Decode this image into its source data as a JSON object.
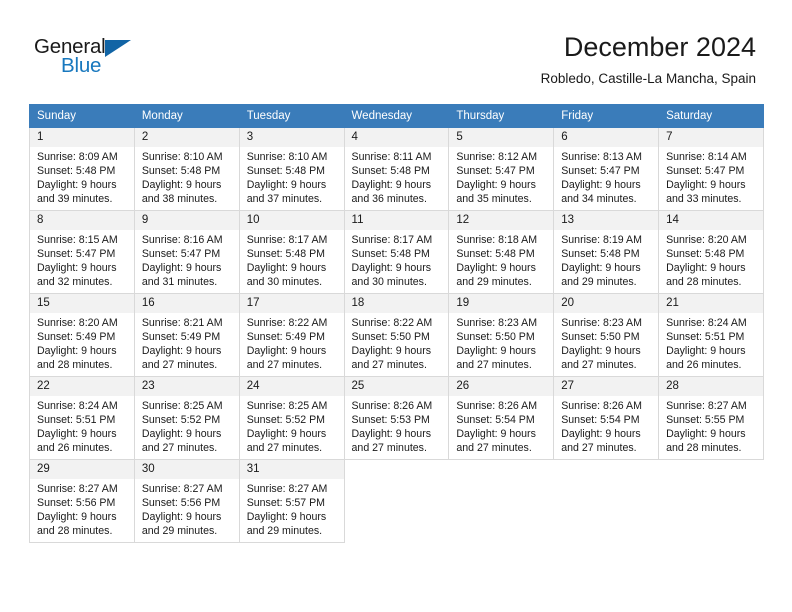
{
  "brand": {
    "name_part1": "General",
    "name_part2": "Blue",
    "triangle_color": "#1164a5",
    "blue_color": "#1878be"
  },
  "header": {
    "title": "December 2024",
    "subtitle": "Robledo, Castille-La Mancha, Spain"
  },
  "theme": {
    "header_bg": "#3a7cba",
    "daynum_bg": "#f2f2f2",
    "grid_border": "#d9d9d9"
  },
  "weekday_headers": [
    "Sunday",
    "Monday",
    "Tuesday",
    "Wednesday",
    "Thursday",
    "Friday",
    "Saturday"
  ],
  "weeks": [
    [
      {
        "day": "1",
        "sunrise": "Sunrise: 8:09 AM",
        "sunset": "Sunset: 5:48 PM",
        "daylight1": "Daylight: 9 hours",
        "daylight2": "and 39 minutes."
      },
      {
        "day": "2",
        "sunrise": "Sunrise: 8:10 AM",
        "sunset": "Sunset: 5:48 PM",
        "daylight1": "Daylight: 9 hours",
        "daylight2": "and 38 minutes."
      },
      {
        "day": "3",
        "sunrise": "Sunrise: 8:10 AM",
        "sunset": "Sunset: 5:48 PM",
        "daylight1": "Daylight: 9 hours",
        "daylight2": "and 37 minutes."
      },
      {
        "day": "4",
        "sunrise": "Sunrise: 8:11 AM",
        "sunset": "Sunset: 5:48 PM",
        "daylight1": "Daylight: 9 hours",
        "daylight2": "and 36 minutes."
      },
      {
        "day": "5",
        "sunrise": "Sunrise: 8:12 AM",
        "sunset": "Sunset: 5:47 PM",
        "daylight1": "Daylight: 9 hours",
        "daylight2": "and 35 minutes."
      },
      {
        "day": "6",
        "sunrise": "Sunrise: 8:13 AM",
        "sunset": "Sunset: 5:47 PM",
        "daylight1": "Daylight: 9 hours",
        "daylight2": "and 34 minutes."
      },
      {
        "day": "7",
        "sunrise": "Sunrise: 8:14 AM",
        "sunset": "Sunset: 5:47 PM",
        "daylight1": "Daylight: 9 hours",
        "daylight2": "and 33 minutes."
      }
    ],
    [
      {
        "day": "8",
        "sunrise": "Sunrise: 8:15 AM",
        "sunset": "Sunset: 5:47 PM",
        "daylight1": "Daylight: 9 hours",
        "daylight2": "and 32 minutes."
      },
      {
        "day": "9",
        "sunrise": "Sunrise: 8:16 AM",
        "sunset": "Sunset: 5:47 PM",
        "daylight1": "Daylight: 9 hours",
        "daylight2": "and 31 minutes."
      },
      {
        "day": "10",
        "sunrise": "Sunrise: 8:17 AM",
        "sunset": "Sunset: 5:48 PM",
        "daylight1": "Daylight: 9 hours",
        "daylight2": "and 30 minutes."
      },
      {
        "day": "11",
        "sunrise": "Sunrise: 8:17 AM",
        "sunset": "Sunset: 5:48 PM",
        "daylight1": "Daylight: 9 hours",
        "daylight2": "and 30 minutes."
      },
      {
        "day": "12",
        "sunrise": "Sunrise: 8:18 AM",
        "sunset": "Sunset: 5:48 PM",
        "daylight1": "Daylight: 9 hours",
        "daylight2": "and 29 minutes."
      },
      {
        "day": "13",
        "sunrise": "Sunrise: 8:19 AM",
        "sunset": "Sunset: 5:48 PM",
        "daylight1": "Daylight: 9 hours",
        "daylight2": "and 29 minutes."
      },
      {
        "day": "14",
        "sunrise": "Sunrise: 8:20 AM",
        "sunset": "Sunset: 5:48 PM",
        "daylight1": "Daylight: 9 hours",
        "daylight2": "and 28 minutes."
      }
    ],
    [
      {
        "day": "15",
        "sunrise": "Sunrise: 8:20 AM",
        "sunset": "Sunset: 5:49 PM",
        "daylight1": "Daylight: 9 hours",
        "daylight2": "and 28 minutes."
      },
      {
        "day": "16",
        "sunrise": "Sunrise: 8:21 AM",
        "sunset": "Sunset: 5:49 PM",
        "daylight1": "Daylight: 9 hours",
        "daylight2": "and 27 minutes."
      },
      {
        "day": "17",
        "sunrise": "Sunrise: 8:22 AM",
        "sunset": "Sunset: 5:49 PM",
        "daylight1": "Daylight: 9 hours",
        "daylight2": "and 27 minutes."
      },
      {
        "day": "18",
        "sunrise": "Sunrise: 8:22 AM",
        "sunset": "Sunset: 5:50 PM",
        "daylight1": "Daylight: 9 hours",
        "daylight2": "and 27 minutes."
      },
      {
        "day": "19",
        "sunrise": "Sunrise: 8:23 AM",
        "sunset": "Sunset: 5:50 PM",
        "daylight1": "Daylight: 9 hours",
        "daylight2": "and 27 minutes."
      },
      {
        "day": "20",
        "sunrise": "Sunrise: 8:23 AM",
        "sunset": "Sunset: 5:50 PM",
        "daylight1": "Daylight: 9 hours",
        "daylight2": "and 27 minutes."
      },
      {
        "day": "21",
        "sunrise": "Sunrise: 8:24 AM",
        "sunset": "Sunset: 5:51 PM",
        "daylight1": "Daylight: 9 hours",
        "daylight2": "and 26 minutes."
      }
    ],
    [
      {
        "day": "22",
        "sunrise": "Sunrise: 8:24 AM",
        "sunset": "Sunset: 5:51 PM",
        "daylight1": "Daylight: 9 hours",
        "daylight2": "and 26 minutes."
      },
      {
        "day": "23",
        "sunrise": "Sunrise: 8:25 AM",
        "sunset": "Sunset: 5:52 PM",
        "daylight1": "Daylight: 9 hours",
        "daylight2": "and 27 minutes."
      },
      {
        "day": "24",
        "sunrise": "Sunrise: 8:25 AM",
        "sunset": "Sunset: 5:52 PM",
        "daylight1": "Daylight: 9 hours",
        "daylight2": "and 27 minutes."
      },
      {
        "day": "25",
        "sunrise": "Sunrise: 8:26 AM",
        "sunset": "Sunset: 5:53 PM",
        "daylight1": "Daylight: 9 hours",
        "daylight2": "and 27 minutes."
      },
      {
        "day": "26",
        "sunrise": "Sunrise: 8:26 AM",
        "sunset": "Sunset: 5:54 PM",
        "daylight1": "Daylight: 9 hours",
        "daylight2": "and 27 minutes."
      },
      {
        "day": "27",
        "sunrise": "Sunrise: 8:26 AM",
        "sunset": "Sunset: 5:54 PM",
        "daylight1": "Daylight: 9 hours",
        "daylight2": "and 27 minutes."
      },
      {
        "day": "28",
        "sunrise": "Sunrise: 8:27 AM",
        "sunset": "Sunset: 5:55 PM",
        "daylight1": "Daylight: 9 hours",
        "daylight2": "and 28 minutes."
      }
    ],
    [
      {
        "day": "29",
        "sunrise": "Sunrise: 8:27 AM",
        "sunset": "Sunset: 5:56 PM",
        "daylight1": "Daylight: 9 hours",
        "daylight2": "and 28 minutes."
      },
      {
        "day": "30",
        "sunrise": "Sunrise: 8:27 AM",
        "sunset": "Sunset: 5:56 PM",
        "daylight1": "Daylight: 9 hours",
        "daylight2": "and 29 minutes."
      },
      {
        "day": "31",
        "sunrise": "Sunrise: 8:27 AM",
        "sunset": "Sunset: 5:57 PM",
        "daylight1": "Daylight: 9 hours",
        "daylight2": "and 29 minutes."
      },
      null,
      null,
      null,
      null
    ]
  ]
}
